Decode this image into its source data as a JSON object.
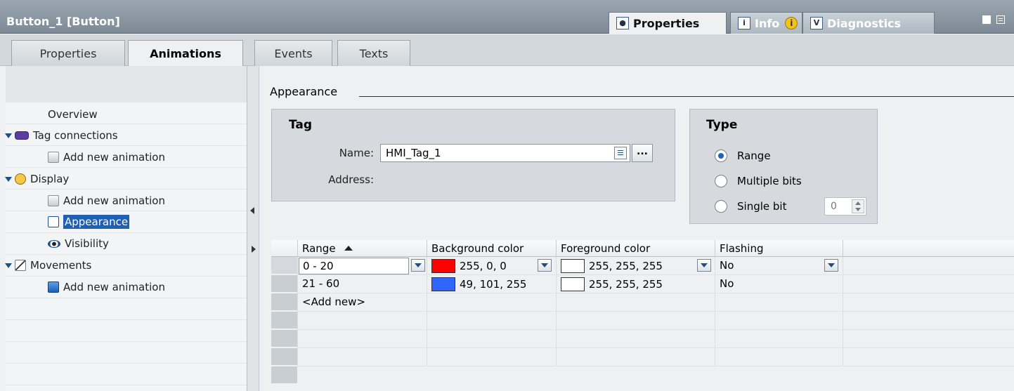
{
  "window": {
    "title": "Button_1 [Button]"
  },
  "inspector_tabs": [
    {
      "label": "Properties",
      "icon": "properties-icon",
      "active": true
    },
    {
      "label": "Info",
      "icon": "info-icon",
      "badge_icon": "info-badge-icon"
    },
    {
      "label": "Diagnostics",
      "icon": "diagnostics-icon"
    }
  ],
  "tabs": [
    {
      "label": "Properties"
    },
    {
      "label": "Animations",
      "active": true
    },
    {
      "label": "Events"
    },
    {
      "label": "Texts"
    }
  ],
  "nav": {
    "items": [
      {
        "label": "Overview",
        "level": 1
      },
      {
        "label": "Tag connections",
        "expanded": true,
        "icon": "tag-connection-icon"
      },
      {
        "label": "Add new animation",
        "level": 1,
        "icon": "add-animation-icon"
      },
      {
        "label": "Display",
        "expanded": true,
        "icon": "display-icon"
      },
      {
        "label": "Add new animation",
        "level": 1,
        "icon": "add-animation-icon"
      },
      {
        "label": "Appearance",
        "level": 1,
        "selected": true,
        "icon": "appearance-icon"
      },
      {
        "label": "Visibility",
        "level": 1,
        "icon": "visibility-icon"
      },
      {
        "label": "Movements",
        "expanded": true,
        "icon": "movements-icon"
      },
      {
        "label": "Add new animation",
        "level": 1,
        "icon": "add-animation-blue-icon"
      }
    ]
  },
  "main": {
    "section_title": "Appearance",
    "tag_box": {
      "title": "Tag",
      "name_label": "Name:",
      "name_value": "HMI_Tag_1",
      "address_label": "Address:",
      "dots_label": "..."
    },
    "type_box": {
      "title": "Type",
      "options": [
        {
          "label": "Range",
          "selected": true
        },
        {
          "label": "Multiple bits",
          "selected": false
        },
        {
          "label": "Single bit",
          "selected": false
        }
      ],
      "single_bit_value": "0"
    },
    "grid": {
      "columns": [
        "Range",
        "Background color",
        "Foreground color",
        "Flashing"
      ],
      "rows": [
        {
          "range": "0 - 20",
          "bg_color": "#ff0000",
          "bg_value": "255, 0, 0",
          "fg_color": "#ffffff",
          "fg_value": "255, 255, 255",
          "flashing": "No"
        },
        {
          "range": "21 - 60",
          "bg_color": "#3165ff",
          "bg_value": "49, 101, 255",
          "fg_color": "#ffffff",
          "fg_value": "255, 255, 255",
          "flashing": "No"
        }
      ],
      "add_new_label": "<Add new>"
    }
  }
}
